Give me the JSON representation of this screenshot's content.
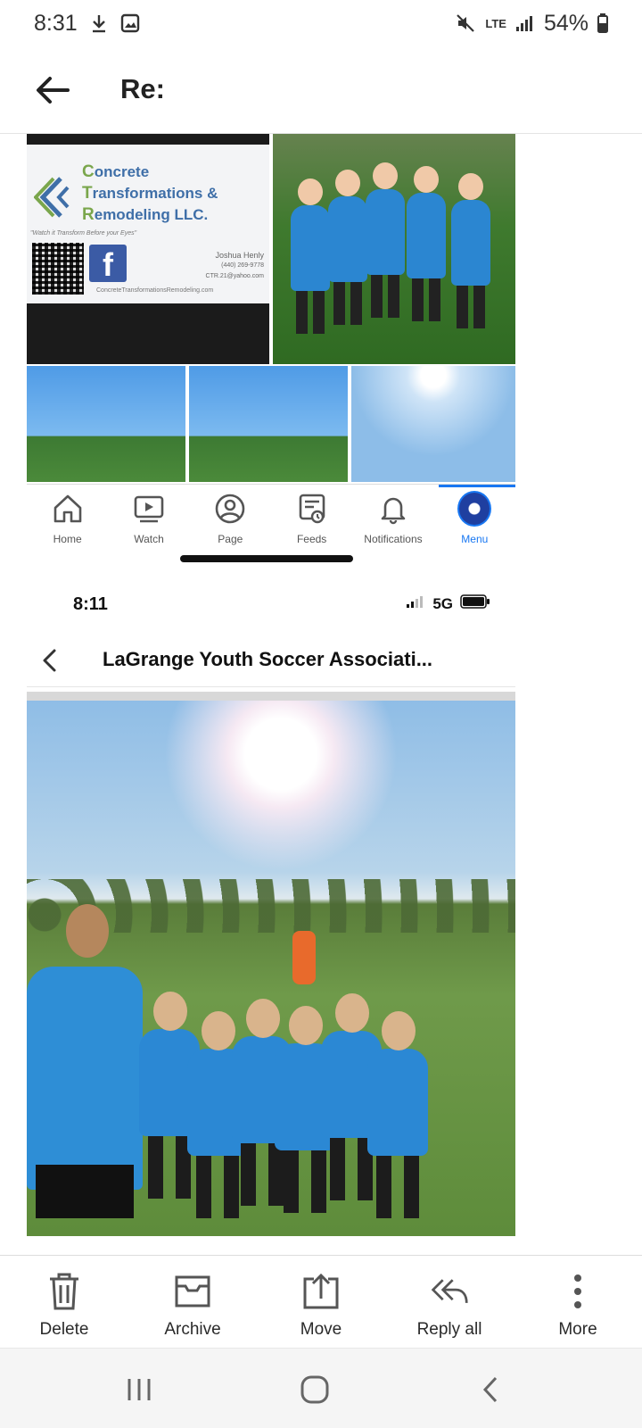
{
  "status_bar": {
    "time": "8:31",
    "network": "LTE",
    "battery": "54%"
  },
  "header": {
    "subject": "Re:"
  },
  "screenshot_1": {
    "business_card": {
      "line1_cap": "C",
      "line1_rest": "oncrete",
      "line2_cap": "T",
      "line2_rest": "ransformations &",
      "line3_cap": "R",
      "line3_rest": "emodeling LLC.",
      "tagline": "\"Watch it Transform Before your Eyes\"",
      "contact_name": "Joshua Henly",
      "contact_phone": "(440) 269-9778",
      "contact_email": "CTR.21@yahoo.com",
      "website": "ConcreteTransformationsRemodeling.com"
    },
    "fb_nav": [
      {
        "label": "Home",
        "icon": "home-icon"
      },
      {
        "label": "Watch",
        "icon": "watch-icon"
      },
      {
        "label": "Page",
        "icon": "page-icon"
      },
      {
        "label": "Feeds",
        "icon": "feeds-icon"
      },
      {
        "label": "Notifications",
        "icon": "bell-icon"
      },
      {
        "label": "Menu",
        "icon": "menu-avatar-icon",
        "active": true
      }
    ],
    "accent_color": "#1877f2"
  },
  "screenshot_2": {
    "time": "8:11",
    "network": "5G",
    "title": "LaGrange Youth Soccer Associati..."
  },
  "actions": [
    {
      "label": "Delete",
      "icon": "trash-icon"
    },
    {
      "label": "Archive",
      "icon": "archive-icon"
    },
    {
      "label": "Move",
      "icon": "move-icon"
    },
    {
      "label": "Reply all",
      "icon": "reply-all-icon"
    },
    {
      "label": "More",
      "icon": "more-vert-icon"
    }
  ],
  "nav_bar": {
    "buttons": [
      "recents-icon",
      "home-circle-icon",
      "back-chevron-icon"
    ]
  }
}
